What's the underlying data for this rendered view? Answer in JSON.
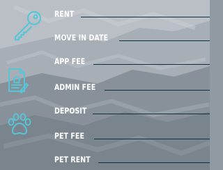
{
  "colors": {
    "label": "#ffffff",
    "line": "#0f2f42",
    "icon_stroke": "#57c5d6"
  },
  "icons": [
    "key-icon",
    "house-document-icon",
    "paw-print-icon"
  ],
  "fields": [
    {
      "label": "RENT"
    },
    {
      "label": "MOVE IN DATE"
    },
    {
      "label": "APP FEE"
    },
    {
      "label": "ADMIN FEE"
    },
    {
      "label": "DEPOSIT"
    },
    {
      "label": "PET FEE"
    },
    {
      "label": "PET RENT"
    }
  ]
}
